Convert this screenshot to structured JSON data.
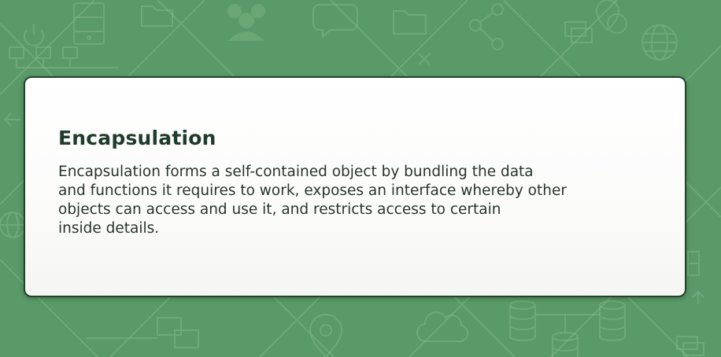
{
  "slide": {
    "title": "Encapsulation",
    "body": "Encapsulation forms a self-contained object by bundling the data\nand functions it requires to work, exposes an interface whereby other\nobjects can access and use it, and restricts access to certain\ninside details."
  },
  "background": {
    "color": "#5a9968",
    "icons": [
      "server-icon",
      "power-icon",
      "sitemap-icon",
      "folder-icon",
      "users-icon",
      "chat-bubble-icon",
      "share-icon",
      "location-pin-icon",
      "windows-icon",
      "globe-icon",
      "close-icon",
      "database-icon",
      "cloud-icon",
      "arrow-left-icon",
      "arrow-up-icon"
    ]
  }
}
